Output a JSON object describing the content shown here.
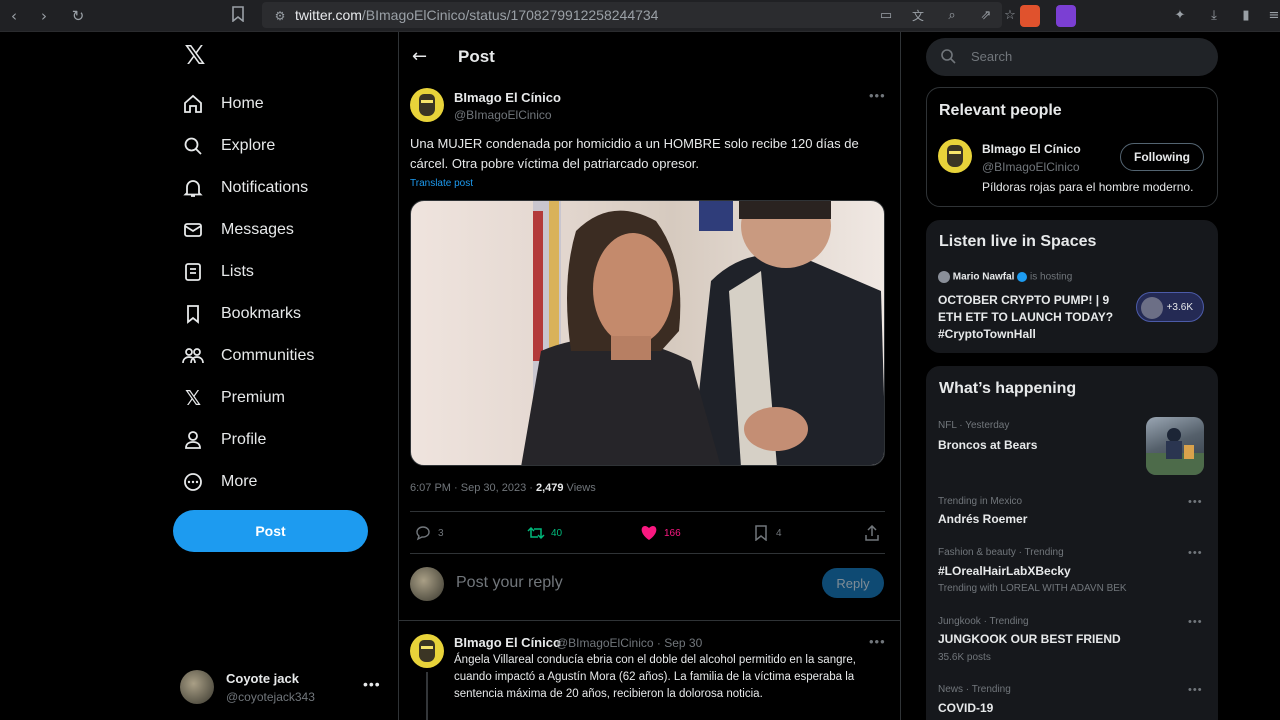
{
  "browser": {
    "url_domain": "twitter.com",
    "url_path": "/BImagoElCinico/status/1708279912258244734"
  },
  "nav": {
    "items": [
      {
        "label": "Home",
        "icon": "home-icon"
      },
      {
        "label": "Explore",
        "icon": "search-icon"
      },
      {
        "label": "Notifications",
        "icon": "bell-icon"
      },
      {
        "label": "Messages",
        "icon": "envelope-icon"
      },
      {
        "label": "Lists",
        "icon": "list-icon"
      },
      {
        "label": "Bookmarks",
        "icon": "bookmark-icon"
      },
      {
        "label": "Communities",
        "icon": "communities-icon"
      },
      {
        "label": "Premium",
        "icon": "x-logo-icon"
      },
      {
        "label": "Profile",
        "icon": "person-icon"
      },
      {
        "label": "More",
        "icon": "more-circle-icon"
      }
    ],
    "post_button": "Post"
  },
  "account": {
    "name": "Coyote jack",
    "handle": "@coyotejack343"
  },
  "header": {
    "title": "Post"
  },
  "tweet": {
    "author_name": "BImago El Cínico",
    "author_handle": "@BImagoElCinico",
    "text": "Una MUJER condenada por homicidio a un HOMBRE solo recibe 120 días de cárcel. Otra pobre víctima del patriarcado opresor.",
    "translate": "Translate post",
    "time": "6:07 PM · Sep 30, 2023 · ",
    "views_count": "2,479",
    "views_label": " Views",
    "replies": "3",
    "reposts": "40",
    "likes": "166",
    "bookmarks": "4"
  },
  "reply_box": {
    "placeholder": "Post your reply",
    "button": "Reply"
  },
  "thread_tweet": {
    "author_name": "BImago El Cínico",
    "author_handle": "@BImagoElCinico · Sep 30",
    "text": "Ángela Villareal conducía ebria con el doble del alcohol permitido en la sangre, cuando impactó a Agustín Mora (62 años). La familia de la víctima esperaba la sentencia máxima de 20 años, recibieron la dolorosa noticia."
  },
  "search": {
    "placeholder": "Search"
  },
  "relevant": {
    "title": "Relevant people",
    "name": "BImago El Cínico",
    "handle": "@BImagoElCinico",
    "bio": "Píldoras rojas para el hombre moderno.",
    "button": "Following"
  },
  "spaces": {
    "title": "Listen live in Spaces",
    "host": "Mario Nawfal",
    "status": "is hosting",
    "space_title": "OCTOBER CRYPTO PUMP! | 9 ETH ETF TO LAUNCH TODAY? #CryptoTownHall",
    "listeners": "+3.6K"
  },
  "happening": {
    "title": "What’s happening",
    "trends": [
      {
        "context": "NFL · Yesterday",
        "title": "Broncos at Bears",
        "extra": ""
      },
      {
        "context": "Trending in Mexico",
        "title": "Andrés Roemer",
        "extra": ""
      },
      {
        "context": "Fashion & beauty · Trending",
        "title": "#LOrealHairLabXBecky",
        "extra": "Trending with LOREAL WITH ADAVN BEK"
      },
      {
        "context": "Jungkook · Trending",
        "title": "JUNGKOOK OUR BEST FRIEND",
        "extra": "35.6K posts"
      },
      {
        "context": "News · Trending",
        "title": "COVID-19",
        "extra": ""
      }
    ]
  },
  "colors": {
    "accent": "#1d9bf0",
    "background": "#000000",
    "like": "#f91880",
    "repost": "#00ba7c",
    "avatar": "#e8d33a"
  }
}
